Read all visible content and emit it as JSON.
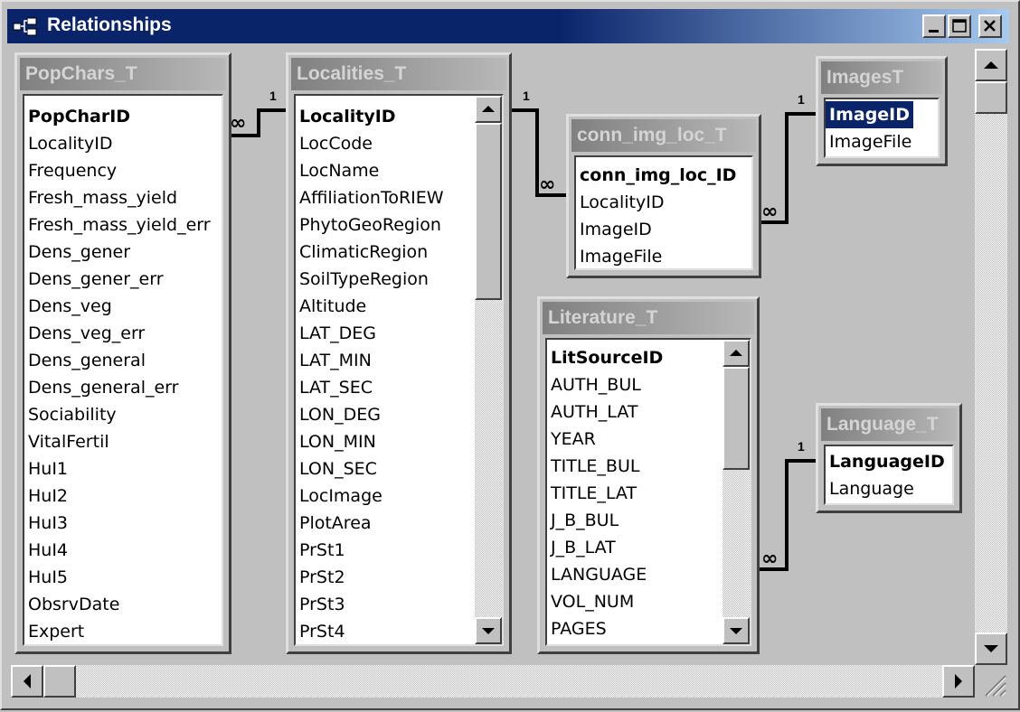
{
  "window": {
    "title": "Relationships",
    "icon": "relationships-icon"
  },
  "tables": {
    "popchars": {
      "title": "PopChars_T",
      "fields": [
        "PopCharID",
        "LocalityID",
        "Frequency",
        "Fresh_mass_yield",
        "Fresh_mass_yield_err",
        "Dens_gener",
        "Dens_gener_err",
        "Dens_veg",
        "Dens_veg_err",
        "Dens_general",
        "Dens_general_err",
        "Sociability",
        "VitalFertil",
        "HuI1",
        "HuI2",
        "HuI3",
        "HuI4",
        "HuI5",
        "ObsrvDate",
        "Expert"
      ]
    },
    "localities": {
      "title": "Localities_T",
      "fields": [
        "LocalityID",
        "LocCode",
        "LocName",
        "AffiliationToRIEW",
        "PhytoGeoRegion",
        "ClimaticRegion",
        "SoilTypeRegion",
        "Altitude",
        "LAT_DEG",
        "LAT_MIN",
        "LAT_SEC",
        "LON_DEG",
        "LON_MIN",
        "LON_SEC",
        "LocImage",
        "PlotArea",
        "PrSt1",
        "PrSt2",
        "PrSt3",
        "PrSt4"
      ]
    },
    "conn_img_loc": {
      "title": "conn_img_loc_T",
      "fields": [
        "conn_img_loc_ID",
        "LocalityID",
        "ImageID",
        "ImageFile"
      ]
    },
    "images": {
      "title": "ImagesT",
      "fields": [
        "ImageID",
        "ImageFile"
      ]
    },
    "literature": {
      "title": "Literature_T",
      "fields": [
        "LitSourceID",
        "AUTH_BUL",
        "AUTH_LAT",
        "YEAR",
        "TITLE_BUL",
        "TITLE_LAT",
        "J_B_BUL",
        "J_B_LAT",
        "LANGUAGE",
        "VOL_NUM",
        "PAGES"
      ]
    },
    "language": {
      "title": "Language_T",
      "fields": [
        "LanguageID",
        "Language"
      ]
    }
  },
  "relationships": {
    "one_label": "1",
    "many_label": "∞"
  },
  "colors": {
    "titlebar_active": "#0a246a",
    "titlebar_gradient_end": "#a6caf0",
    "face": "#c0c0c0",
    "selection": "#0a246a"
  }
}
